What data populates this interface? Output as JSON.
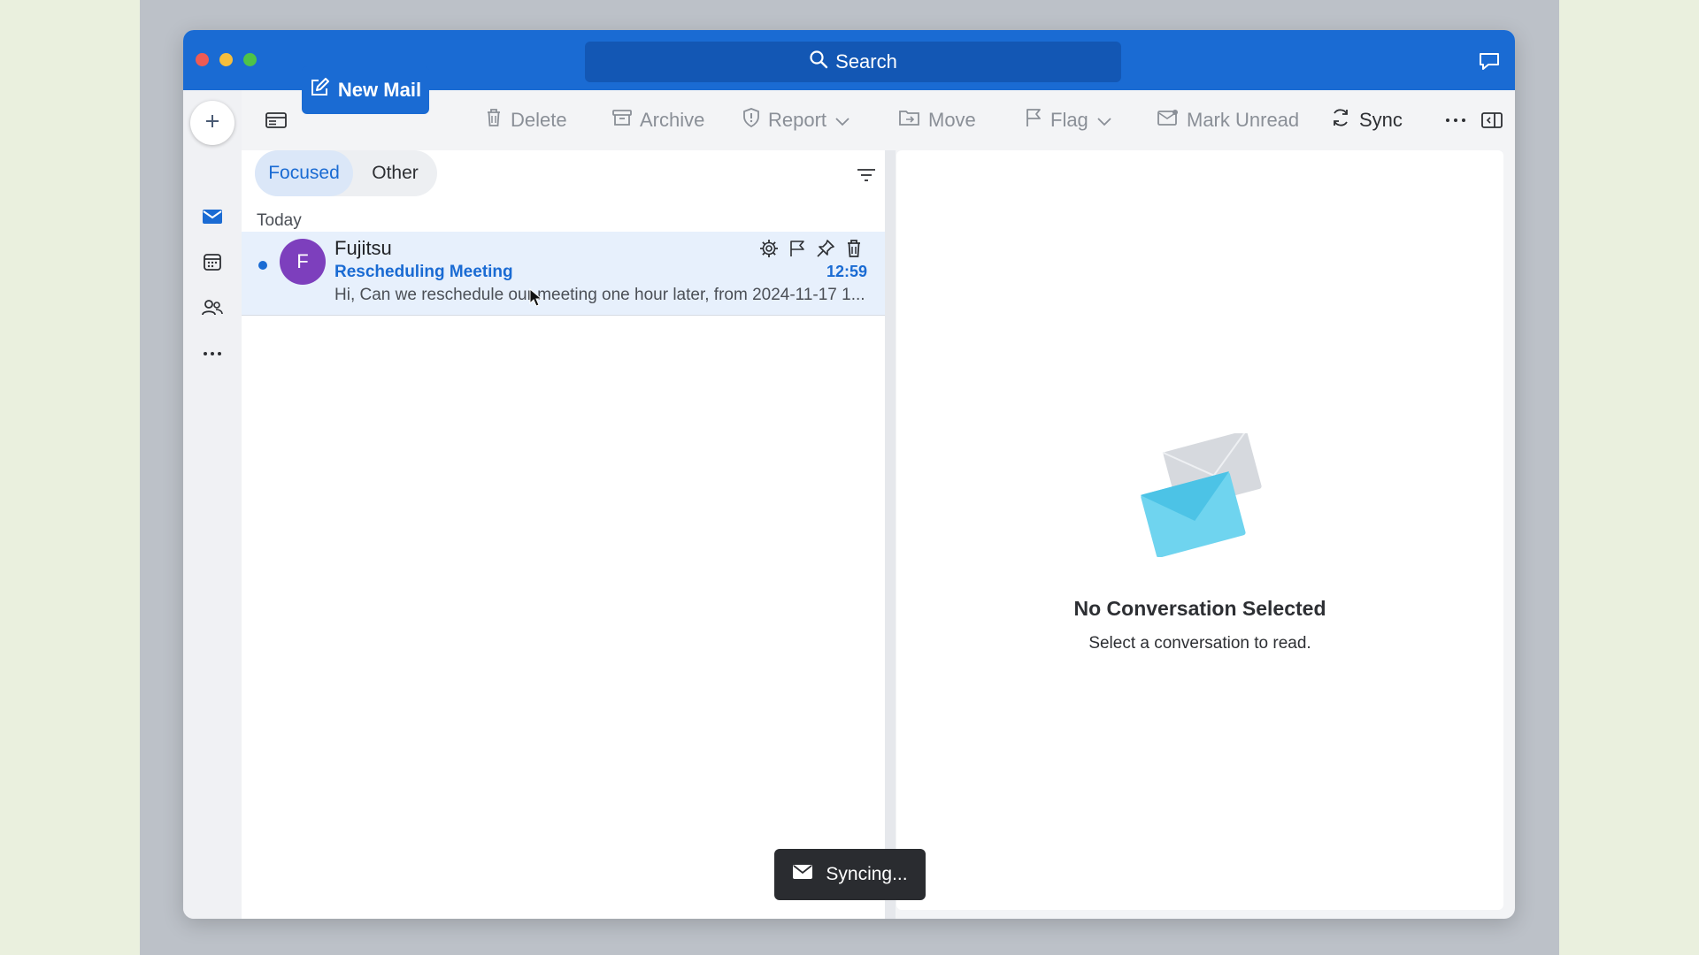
{
  "titlebar": {
    "search_label": "Search"
  },
  "toolbar": {
    "new_mail": "New Mail",
    "delete": "Delete",
    "archive": "Archive",
    "report": "Report",
    "move": "Move",
    "flag": "Flag",
    "mark_unread": "Mark Unread",
    "sync": "Sync"
  },
  "list": {
    "tabs": {
      "focused": "Focused",
      "other": "Other"
    },
    "group_label": "Today",
    "messages": [
      {
        "avatar_initial": "F",
        "sender": "Fujitsu",
        "subject": "Rescheduling Meeting",
        "preview": "Hi, Can we reschedule our meeting one hour later, from 2024-11-17 1...",
        "time": "12:59",
        "unread": true
      }
    ]
  },
  "reading_pane": {
    "empty_title": "No Conversation Selected",
    "empty_subtitle": "Select a conversation to read."
  },
  "toast": {
    "text": "Syncing..."
  },
  "colors": {
    "accent": "#1a6bd3",
    "avatar": "#7d3fbd",
    "unread_row": "#e7f0fc"
  },
  "icons": [
    "search-icon",
    "megaphone-icon",
    "plus-icon",
    "sidebar-toggle-icon",
    "compose-icon",
    "trash-icon",
    "archive-icon",
    "shield-icon",
    "folder-move-icon",
    "flag-icon",
    "envelope-icon",
    "sync-icon",
    "more-icon",
    "panel-icon",
    "mail-icon",
    "calendar-icon",
    "people-icon",
    "filter-icon",
    "gear-icon",
    "pin-icon"
  ]
}
